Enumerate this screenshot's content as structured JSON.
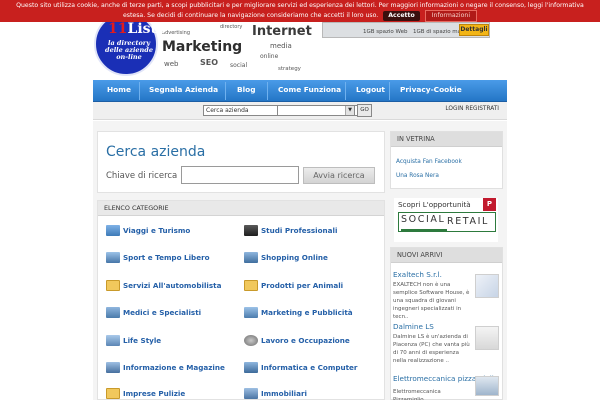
{
  "cookie_bar": {
    "text_before": "Questo sito utilizza cookie, anche di terze parti, a scopi pubblicitari e per migliorare servizi ed esperienza dei lettori. Per maggiori informazioni o negare il consenso, leggi l'informativa estesa. Se decidi di continuare la navigazione consideriamo che accetti il loro uso.",
    "accept_label": "Accetto",
    "info_label": "Informazioni"
  },
  "logo": {
    "number": "11",
    "word": "Listo",
    "tagline": "la directory delle aziende on-line"
  },
  "wordcloud": [
    "Internet",
    "Marketing",
    "SEO",
    "media",
    "web",
    "social",
    "online",
    "advertising",
    "directory",
    "strategy"
  ],
  "banner": {
    "text1": "1GB spazio Web",
    "text2": "1GB di spazio mail",
    "button": "Dettagli"
  },
  "nav": {
    "items": [
      "Home",
      "Segnala Azienda",
      "Blog",
      "Come Funziona",
      "Logout",
      "Privacy-Cookie"
    ]
  },
  "strip": {
    "select_value": "Cerca azienda",
    "go_label": "GO",
    "login_label": "LOGIN REGISTRATI"
  },
  "search_panel": {
    "title": "Cerca azienda",
    "label": "Chiave di ricerca",
    "button": "Avvia ricerca"
  },
  "categories": {
    "header": "ELENCO CATEGORIE",
    "left": [
      "Viaggi e Turismo",
      "Sport e Tempo Libero",
      "Servizi All'automobilista",
      "Medici e Specialisti",
      "Life Style",
      "Informazione e Magazine",
      "Imprese Pulizie"
    ],
    "right": [
      "Studi Professionali",
      "Shopping Online",
      "Prodotti per Animali",
      "Marketing e Pubblicità",
      "Lavoro e Occupazione",
      "Informatica e Computer",
      "Immobiliari"
    ]
  },
  "vetrina": {
    "header": "IN VETRINA",
    "links": [
      "Acquista Fan Facebook",
      "Una Rosa Nera"
    ]
  },
  "social_retail": {
    "title": "Scopri L'opportunità",
    "badge": "P",
    "word1": "SOCIAL",
    "word2": "RETAIL"
  },
  "nuovi_arrivi": {
    "header": "NUOVI ARRIVI",
    "items": [
      {
        "title": "Exaltech S.r.l.",
        "desc": "EXALTECH non è una semplice Software House, è una squadra di giovani ingegneri specializzati in tecn.."
      },
      {
        "title": "Dalmine LS",
        "desc": "Dalmine LS è un'azienda di Piacenza (PC) che vanta più di 70 anni di esperienza nella realizzazione .."
      },
      {
        "title": "Elettromeccanica pizzamiglio",
        "desc": "Elettromeccanica Pizzamiglio"
      }
    ]
  }
}
